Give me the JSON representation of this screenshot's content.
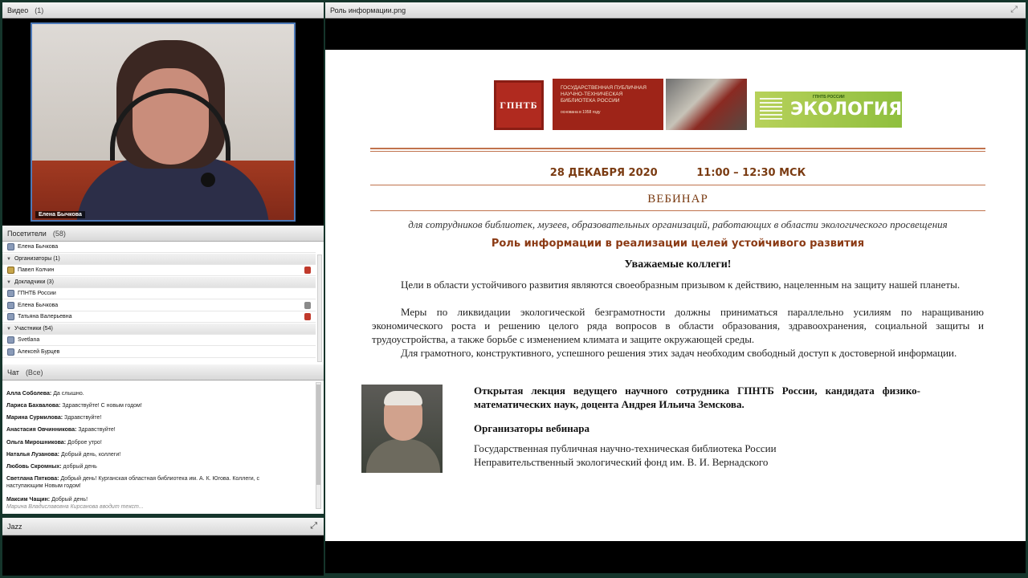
{
  "video": {
    "title": "Видео",
    "count": "(1)",
    "speaker_name": "Елена Бычкова"
  },
  "visitors": {
    "title": "Посетители",
    "count": "(58)",
    "rows": [
      {
        "label": "Елена Бычкова",
        "kind": "user"
      },
      {
        "label": "Организаторы (1)",
        "kind": "group"
      },
      {
        "label": "Павел Колчин",
        "kind": "host"
      },
      {
        "label": "Докладчики (3)",
        "kind": "group"
      },
      {
        "label": "ГПНТБ России",
        "kind": "user"
      },
      {
        "label": "Елена Бычкова",
        "kind": "user"
      },
      {
        "label": "Татьяна Валерьевна",
        "kind": "user"
      },
      {
        "label": "Участники (54)",
        "kind": "group"
      },
      {
        "label": "Svetlana",
        "kind": "user"
      },
      {
        "label": "Алексей Бурцев",
        "kind": "user"
      }
    ]
  },
  "chat": {
    "title": "Чат",
    "scope": "(Все)",
    "messages": [
      {
        "author": "Алла Соболева:",
        "text": "Да слышно."
      },
      {
        "author": "Лариса Бахвалова:",
        "text": "Здравствуйте! С новым годом!"
      },
      {
        "author": "Марина Сурмилова:",
        "text": "Здравствуйте!"
      },
      {
        "author": "Анастасия Овчинникова:",
        "text": "Здравствуйте!"
      },
      {
        "author": "Ольга Мирошникова:",
        "text": "Доброе утро!"
      },
      {
        "author": "Наталья Лузанова:",
        "text": "Добрый день, коллеги!"
      },
      {
        "author": "Любовь Скромных:",
        "text": "добрый день"
      },
      {
        "author": "Светлана Пяткова:",
        "text": "Добрый день! Курганская областная библиотека им. А. К. Югова.  Коллеги, с наступающим Новым годом!"
      },
      {
        "author": "Максим Чащин:",
        "text": "Добрый день!"
      }
    ],
    "typing": "Марина Владиславовна Кирсанова вводит текст..."
  },
  "jazz": {
    "title": "Jazz"
  },
  "presentation": {
    "filename": "Роль информации.png",
    "slide": {
      "logo_abbr": "ГПНТБ",
      "logo_org": "Государственная публичная научно-техническая библиотека России",
      "logo_org_sub": "основана в 1958 году",
      "eco_logo": "ЭКОЛОГИЯ",
      "eco_logo_small": "ГПНТБ РОССИИ",
      "date": "28 ДЕКАБРЯ 2020",
      "time": "11:00 – 12:30 МСК",
      "event_type": "ВЕБИНАР",
      "audience": "для сотрудников библиотек, музеев, образовательных организаций, работающих в области экологического просвещения",
      "topic": "Роль информации в реализации целей устойчивого развития",
      "greeting": "Уважаемые коллеги!",
      "paragraphs": [
        "Цели в области устойчивого развития являются своеобразным призывом к действию, нацеленным на защиту нашей планеты.",
        "Меры по ликвидации экологической безграмотности должны приниматься параллельно усилиям по наращиванию экономического роста и решению целого ряда вопросов в области образования, здравоохранения, социальной защиты и трудоустройства, а также борьбе с изменением климата и защите окружающей среды.",
        "Для грамотного, конструктивного, успешного решения этих задач необходим свободный доступ к достоверной информации."
      ],
      "lecture": "Открытая лекция ведущего научного сотрудника ГПНТБ России, кандидата физико-математических наук, доцента Андрея Ильича Земскова.",
      "organizers_title": "Организаторы вебинара",
      "organizers": [
        "Государственная публичная научно-техническая библиотека России",
        "Неправительственный экологический фонд им. В. И. Вернадского"
      ]
    }
  },
  "icons": {
    "expand": "⤢"
  }
}
